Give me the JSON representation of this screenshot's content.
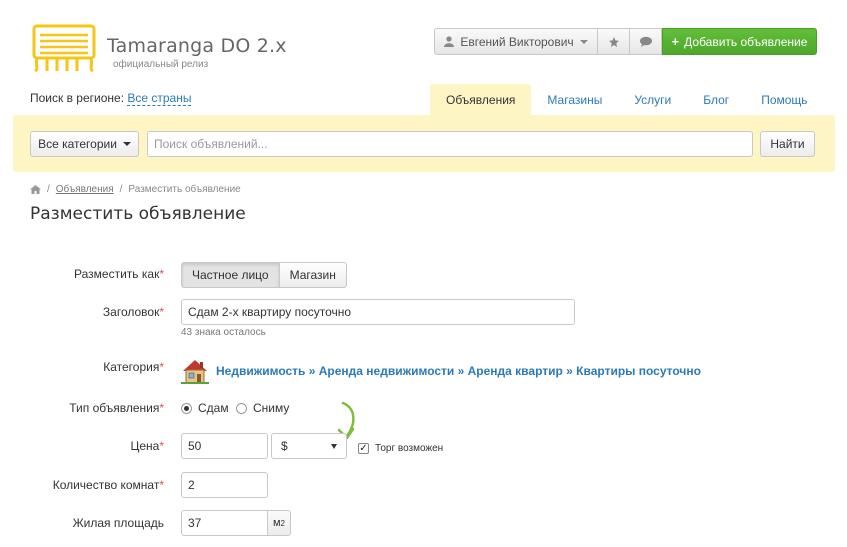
{
  "brand": {
    "title": "Tamaranga DO 2.x",
    "subtitle": "официальный релиз",
    "logo_color": "#f5c518"
  },
  "header": {
    "user_name": "Евгений Викторович",
    "add_button_label": "Добавить объявление",
    "add_button_color": "#56b030"
  },
  "region": {
    "label": "Поиск в регионе:",
    "value": "Все страны"
  },
  "nav": {
    "items": [
      {
        "label": "Объявления",
        "active": true
      },
      {
        "label": "Магазины",
        "active": false
      },
      {
        "label": "Услуги",
        "active": false
      },
      {
        "label": "Блог",
        "active": false
      },
      {
        "label": "Помощь",
        "active": false
      }
    ]
  },
  "search": {
    "category_button": "Все категории",
    "placeholder": "Поиск объявлений...",
    "submit_label": "Найти",
    "bar_color": "#fdf5c3"
  },
  "breadcrumb": {
    "link": "Объявления",
    "current": "Разместить объявление"
  },
  "page": {
    "title": "Разместить объявление"
  },
  "form": {
    "post_as": {
      "label": "Разместить как",
      "options": [
        "Частное лицо",
        "Магазин"
      ],
      "selected": "Частное лицо"
    },
    "title_field": {
      "label": "Заголовок",
      "value": "Сдам 2-х квартиру посуточно",
      "hint": "43 знака осталось"
    },
    "category": {
      "label": "Категория",
      "path": "Недвижимость » Аренда недвижимости » Аренда квартир » Квартиры посуточно",
      "icon": "house-icon"
    },
    "ad_type": {
      "label": "Тип объявления",
      "options": [
        "Сдам",
        "Сниму"
      ],
      "selected": "Сдам"
    },
    "price": {
      "label": "Цена",
      "value": "50",
      "currency": "$",
      "negotiable_label": "Торг возможен",
      "negotiable_checked": true
    },
    "rooms": {
      "label": "Количество комнат",
      "value": "2"
    },
    "living_area": {
      "label": "Жилая площадь",
      "value": "37",
      "unit": "м",
      "unit_sup": "2"
    },
    "required_mark": "*"
  }
}
